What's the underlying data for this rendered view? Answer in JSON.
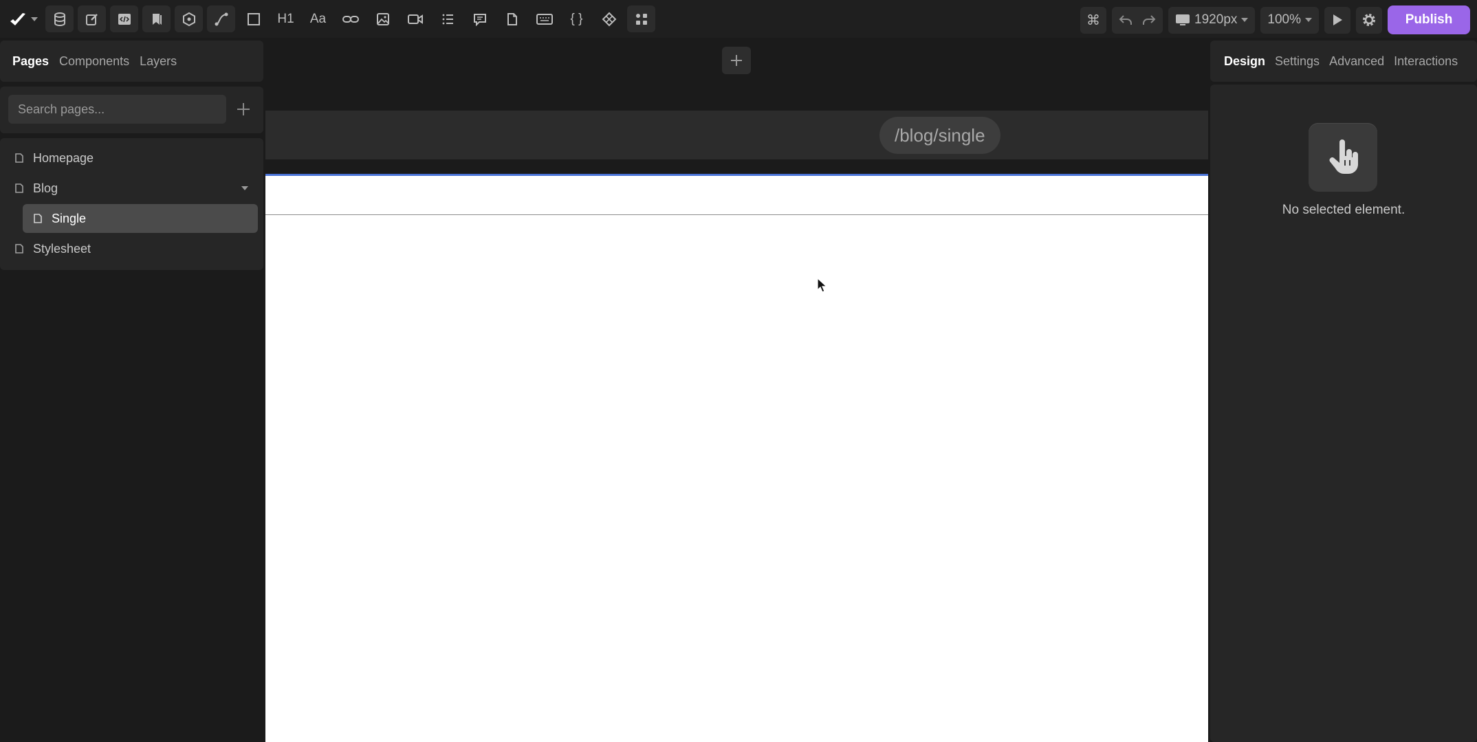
{
  "toolbar": {
    "breakpoint_label": "1920px",
    "zoom_label": "100%",
    "publish_label": "Publish",
    "heading_tool_label": "H1",
    "text_tool_label": "Aa",
    "code_tool_label": "{ }"
  },
  "left_panel": {
    "tabs": [
      {
        "label": "Pages",
        "active": true
      },
      {
        "label": "Components",
        "active": false
      },
      {
        "label": "Layers",
        "active": false
      }
    ],
    "search_placeholder": "Search pages...",
    "pages": [
      {
        "label": "Homepage",
        "nested": false,
        "selected": false
      },
      {
        "label": "Blog",
        "nested": false,
        "selected": false,
        "expandable": true
      },
      {
        "label": "Single",
        "nested": true,
        "selected": true
      },
      {
        "label": "Stylesheet",
        "nested": false,
        "selected": false
      }
    ]
  },
  "canvas": {
    "url_path": "/blog/single"
  },
  "right_panel": {
    "tabs": [
      {
        "label": "Design",
        "active": true
      },
      {
        "label": "Settings",
        "active": false
      },
      {
        "label": "Advanced",
        "active": false
      },
      {
        "label": "Interactions",
        "active": false
      }
    ],
    "empty_message": "No selected element."
  },
  "colors": {
    "accent": "#9a66e8",
    "canvas_selection": "#4a73d6",
    "panel_bg": "#262626",
    "app_bg": "#1b1b1b"
  }
}
